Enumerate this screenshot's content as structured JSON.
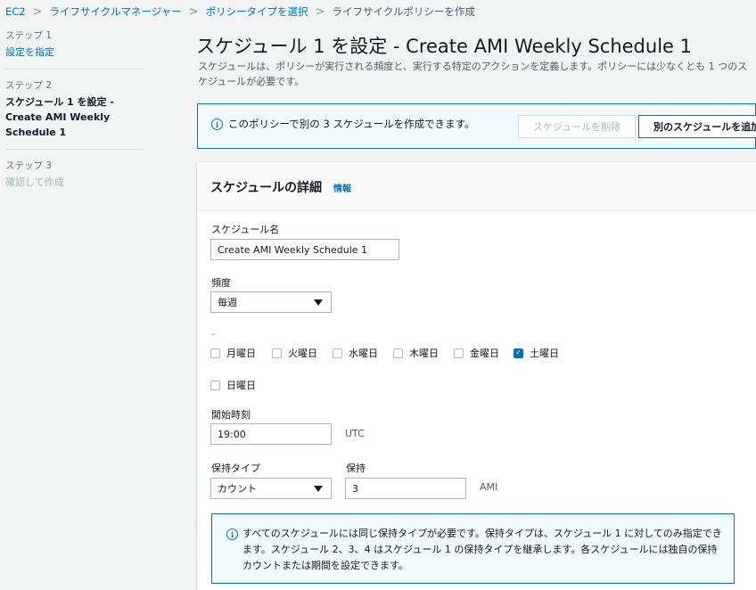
{
  "breadcrumb": {
    "items": [
      "EC2",
      "ライフサイクルマネージャー",
      "ポリシータイプを選択"
    ],
    "current": "ライフサイクルポリシーを作成",
    "separator": ">"
  },
  "steps": [
    {
      "label": "ステップ 1",
      "text": "設定を指定"
    },
    {
      "label": "ステップ 2",
      "text": "スケジュール 1 を設定 - Create AMI Weekly Schedule 1"
    },
    {
      "label": "ステップ 3",
      "text": "確認して作成"
    }
  ],
  "page": {
    "title": "スケジュール 1 を設定 - Create AMI Weekly Schedule 1",
    "description": "スケジュールは、ポリシーが実行される頻度と、実行する特定のアクションを定義します。ポリシーには少なくとも 1 つのスケジュールが必要です。"
  },
  "info_alert": {
    "icon": "info-icon",
    "text": "このポリシーで別の 3 スケジュールを作成できます。",
    "delete_button": "スケジュールを削除",
    "add_button": "別のスケジュールを追加"
  },
  "panel": {
    "heading": "スケジュールの詳細",
    "info_link": "情報",
    "schedule_name_label": "スケジュール名",
    "schedule_name_value": "Create AMI Weekly Schedule 1",
    "frequency_label": "頻度",
    "frequency_value": "毎週",
    "days_label": "-",
    "days": [
      {
        "label": "月曜日",
        "checked": false
      },
      {
        "label": "火曜日",
        "checked": false
      },
      {
        "label": "水曜日",
        "checked": false
      },
      {
        "label": "木曜日",
        "checked": false
      },
      {
        "label": "金曜日",
        "checked": false
      },
      {
        "label": "土曜日",
        "checked": true
      },
      {
        "label": "日曜日",
        "checked": false
      }
    ],
    "start_time_label": "開始時刻",
    "start_time_value": "19:00",
    "start_time_unit": "UTC",
    "retention_type_label": "保持タイプ",
    "retention_type_value": "カウント",
    "retention_label": "保持",
    "retention_value": "3",
    "retention_unit": "AMI",
    "note": "すべてのスケジュールには同じ保持タイプが必要です。保持タイプは、スケジュール 1 に対してのみ指定できます。スケジュール 2、3、4 はスケジュール 1 の保持タイプを継承します。各スケジュールには独自の保持カウントまたは期間を設定できます。"
  },
  "colors": {
    "link": "#0073bb",
    "info_bg": "#f1faff",
    "page_bg": "#f2f3f3"
  }
}
